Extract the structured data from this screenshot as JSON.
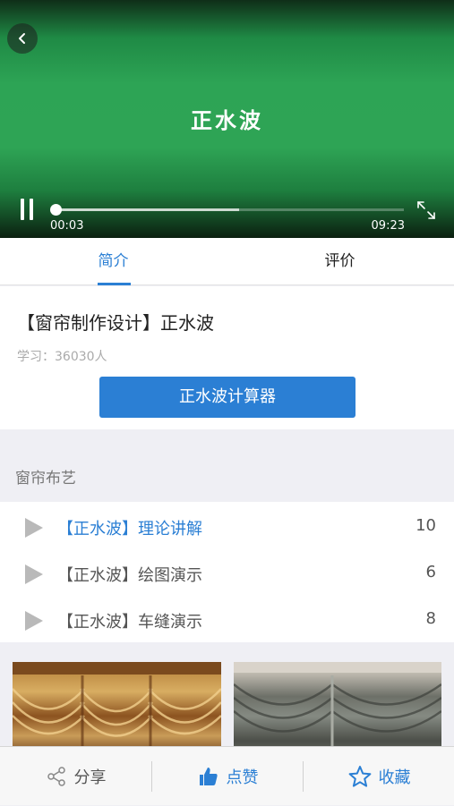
{
  "player": {
    "title": "正水波",
    "current_time": "00:03",
    "total_time": "09:23",
    "played_fraction": 0.005,
    "buffered_fraction": 0.53
  },
  "tabs": [
    {
      "label": "简介",
      "active": true
    },
    {
      "label": "评价",
      "active": false
    }
  ],
  "course": {
    "title": "【窗帘制作设计】正水波",
    "learn_count": "学习：36030人",
    "calc_button": "正水波计算器"
  },
  "section": {
    "title": "窗帘布艺"
  },
  "lessons": [
    {
      "name": "【正水波】理论讲解",
      "count": "10",
      "active": true
    },
    {
      "name": "【正水波】绘图演示",
      "count": "6",
      "active": false
    },
    {
      "name": "【正水波】车缝演示",
      "count": "8",
      "active": false
    }
  ],
  "bottom_bar": {
    "share": "分享",
    "like": "点赞",
    "favorite": "收藏"
  },
  "colors": {
    "accent": "#2b7fd4",
    "player_green": "#2ea455",
    "icon_gray": "#b9b9b9"
  },
  "icons": [
    "back-icon",
    "pause-icon",
    "fullscreen-icon",
    "play-icon",
    "share-icon",
    "thumbs-up-icon",
    "star-icon"
  ]
}
